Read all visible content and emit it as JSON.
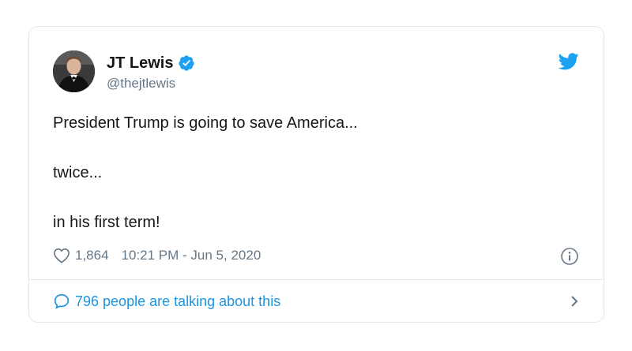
{
  "author": {
    "name": "JT Lewis",
    "handle": "@thejtlewis",
    "verified": true
  },
  "tweet": {
    "lines": [
      "President Trump is going to save America...",
      "twice...",
      "in his first term!"
    ],
    "likes": "1,864",
    "timestamp": "10:21 PM - Jun 5, 2020"
  },
  "footer": {
    "talking_text": "796 people are talking about this"
  },
  "icons": {
    "verified": "verified-badge-icon",
    "bird": "twitter-bird-icon",
    "heart": "heart-icon",
    "info": "info-icon",
    "bubble": "speech-bubble-icon",
    "chevron": "chevron-right-icon"
  },
  "colors": {
    "brand_blue": "#1da1f2",
    "link_blue": "#1b95e0",
    "muted": "#657786",
    "border": "#e1e8ed"
  }
}
